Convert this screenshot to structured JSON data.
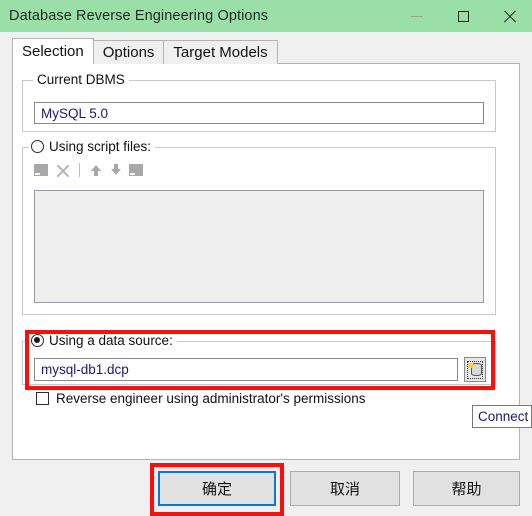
{
  "window": {
    "title": "Database Reverse Engineering Options",
    "controls": {
      "minimize": "minimize-button",
      "maximize": "maximize-button",
      "close": "close-button"
    },
    "titlebar_color": "#9adfa8"
  },
  "tabs": [
    {
      "label": "Selection",
      "active": true
    },
    {
      "label": "Options",
      "active": false
    },
    {
      "label": "Target Models",
      "active": false
    }
  ],
  "selection_tab": {
    "dbms_group": {
      "title": "Current DBMS",
      "value": "MySQL 5.0"
    },
    "script_group": {
      "radio_label": "Using script files:",
      "selected": false,
      "toolbar": [
        "add-file-icon",
        "delete-icon",
        "separator",
        "move-up-icon",
        "move-down-icon",
        "edit-file-icon"
      ],
      "list_items": []
    },
    "datasource_group": {
      "radio_label": "Using a data source:",
      "selected": true,
      "value": "mysql-db1.dcp",
      "browse_icon": "database-browse-icon"
    },
    "admin_checkbox": {
      "label": "Reverse engineer using administrator's permissions",
      "checked": false
    }
  },
  "tooltip": {
    "text": "Connect"
  },
  "buttons": {
    "ok": "确定",
    "cancel": "取消",
    "help": "帮助"
  },
  "annotations": {
    "accent_color": "#f8100f",
    "focus_color": "#0a7ad1"
  }
}
